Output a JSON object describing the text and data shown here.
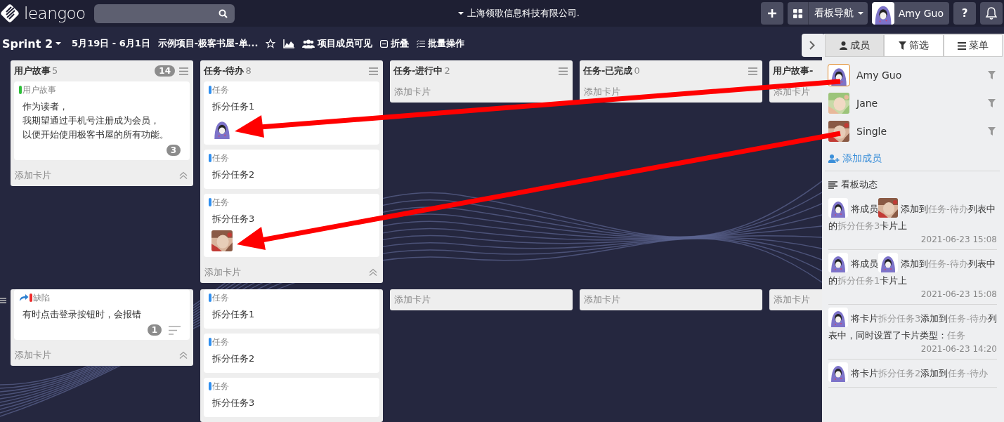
{
  "topbar": {
    "logo": "leangoo",
    "org": "上海领歌信息科技有限公司.",
    "board_nav": "看板导航",
    "user": "Amy Guo",
    "help": "?"
  },
  "subbar": {
    "sprint": "Sprint 2",
    "dates": "5月19日 - 6月1日",
    "project": "示例项目-极客书屋-单...",
    "actions": [
      {
        "kind": "users",
        "label": "项目成员可见"
      },
      {
        "kind": "fold",
        "label": "折叠"
      },
      {
        "kind": "batch",
        "label": "批量操作"
      }
    ]
  },
  "lanes": [
    {
      "handle": false,
      "columns": [
        {
          "title": "用户故事",
          "count": "5",
          "badge": "14",
          "add_label": "添加卡片",
          "collapsible": true,
          "cards": [
            {
              "label": "用户故事",
              "color": "#2fbf3a",
              "linked": false,
              "lines": [
                "作为读者，",
                "我期望通过手机号注册成为会员，",
                "以便开始使用极客书屋的所有功能。"
              ],
              "comments": "3",
              "description": false
            }
          ]
        },
        {
          "title": "任务-待办",
          "count": "8",
          "add_label": "添加卡片",
          "collapsible": true,
          "cards": [
            {
              "label": "任务",
              "color": "#2f8ff0",
              "linked": false,
              "text": "拆分任务1",
              "member": {
                "kind": "hood"
              },
              "description": false
            },
            {
              "label": "任务",
              "color": "#2f8ff0",
              "linked": false,
              "text": "拆分任务2",
              "description": false
            },
            {
              "label": "任务",
              "color": "#2f8ff0",
              "linked": false,
              "text": "拆分任务3",
              "member": {
                "kind": "blurred-photo"
              },
              "description": false
            }
          ]
        },
        {
          "title": "任务-进行中",
          "count": "2",
          "add_label": "添加卡片",
          "collapsible": false
        },
        {
          "title": "任务-已完成",
          "count": "0",
          "add_label": "添加卡片",
          "collapsible": false
        },
        {
          "title": "用户故事-",
          "add_label": "添加卡片"
        }
      ]
    },
    {
      "handle": true,
      "columns": [
        {
          "add_label": "添加卡片",
          "collapsible": true,
          "cards": [
            {
              "label": "缺陷",
              "color": "#ee2a2a",
              "linked": true,
              "text": "有时点击登录按钮时，会报错",
              "comments": "1",
              "description": true
            }
          ]
        },
        {
          "cards": [
            {
              "label": "任务",
              "color": "#2f8ff0",
              "linked": false,
              "text": "拆分任务1",
              "description": false
            },
            {
              "label": "任务",
              "color": "#2f8ff0",
              "linked": false,
              "text": "拆分任务2",
              "description": false
            },
            {
              "label": "任务",
              "color": "#2f8ff0",
              "linked": false,
              "text": "拆分任务3",
              "description": false
            }
          ]
        },
        {
          "add_label": "添加卡片",
          "collapsible": false
        },
        {
          "add_label": "添加卡片",
          "collapsible": false
        },
        {
          "add_label": "添加卡片"
        }
      ]
    }
  ],
  "panel": {
    "tabs": [
      {
        "kind": "user",
        "label": "成员",
        "selected": true
      },
      {
        "kind": "filter",
        "label": "筛选",
        "selected": false
      },
      {
        "kind": "menu",
        "label": "菜单",
        "selected": false
      }
    ],
    "members": [
      {
        "name": "Amy Guo",
        "avatar": {
          "kind": "hood"
        },
        "current": true
      },
      {
        "name": "Jane",
        "avatar": {
          "kind": "child-photo"
        },
        "current": false
      },
      {
        "name": "Single",
        "avatar": {
          "kind": "blurred-photo"
        },
        "current": false
      }
    ],
    "add_member": "添加成员",
    "activity_title": "看板动态",
    "activity": [
      {
        "segments": [
          {
            "kind": "avatar",
            "avatar": {
              "kind": "hood"
            }
          },
          {
            "kind": "text",
            "text": "将成员"
          },
          {
            "kind": "avatar",
            "avatar": {
              "kind": "blurred-photo"
            }
          },
          {
            "kind": "text",
            "text": "添加到"
          },
          {
            "kind": "link",
            "text": "任务-待办"
          },
          {
            "kind": "text",
            "text": "列表中的"
          },
          {
            "kind": "link",
            "text": "拆分任务3"
          },
          {
            "kind": "text",
            "text": "卡片上"
          }
        ],
        "time": "2021-06-23 15:08"
      },
      {
        "segments": [
          {
            "kind": "avatar",
            "avatar": {
              "kind": "hood"
            }
          },
          {
            "kind": "text",
            "text": "将成员"
          },
          {
            "kind": "avatar",
            "avatar": {
              "kind": "hood"
            }
          },
          {
            "kind": "text",
            "text": "添加到"
          },
          {
            "kind": "link",
            "text": "任务-待办"
          },
          {
            "kind": "text",
            "text": "列表中的"
          },
          {
            "kind": "link",
            "text": "拆分任务1"
          },
          {
            "kind": "text",
            "text": "卡片上"
          }
        ],
        "time": "2021-06-23 15:08"
      },
      {
        "segments": [
          {
            "kind": "avatar",
            "avatar": {
              "kind": "hood"
            }
          },
          {
            "kind": "text",
            "text": "将卡片"
          },
          {
            "kind": "link",
            "text": "拆分任务3"
          },
          {
            "kind": "text",
            "text": "添加到"
          },
          {
            "kind": "link",
            "text": "任务-待办"
          },
          {
            "kind": "text",
            "text": "列表中，同时设置了卡片类型："
          },
          {
            "kind": "link",
            "text": "任务"
          }
        ],
        "time": "2021-06-23 14:20"
      },
      {
        "segments": [
          {
            "kind": "avatar",
            "avatar": {
              "kind": "hood"
            }
          },
          {
            "kind": "text",
            "text": "将卡片"
          },
          {
            "kind": "link",
            "text": "拆分任务2"
          },
          {
            "kind": "text",
            "text": "添加到"
          },
          {
            "kind": "link",
            "text": "任务-待办"
          }
        ]
      }
    ]
  }
}
